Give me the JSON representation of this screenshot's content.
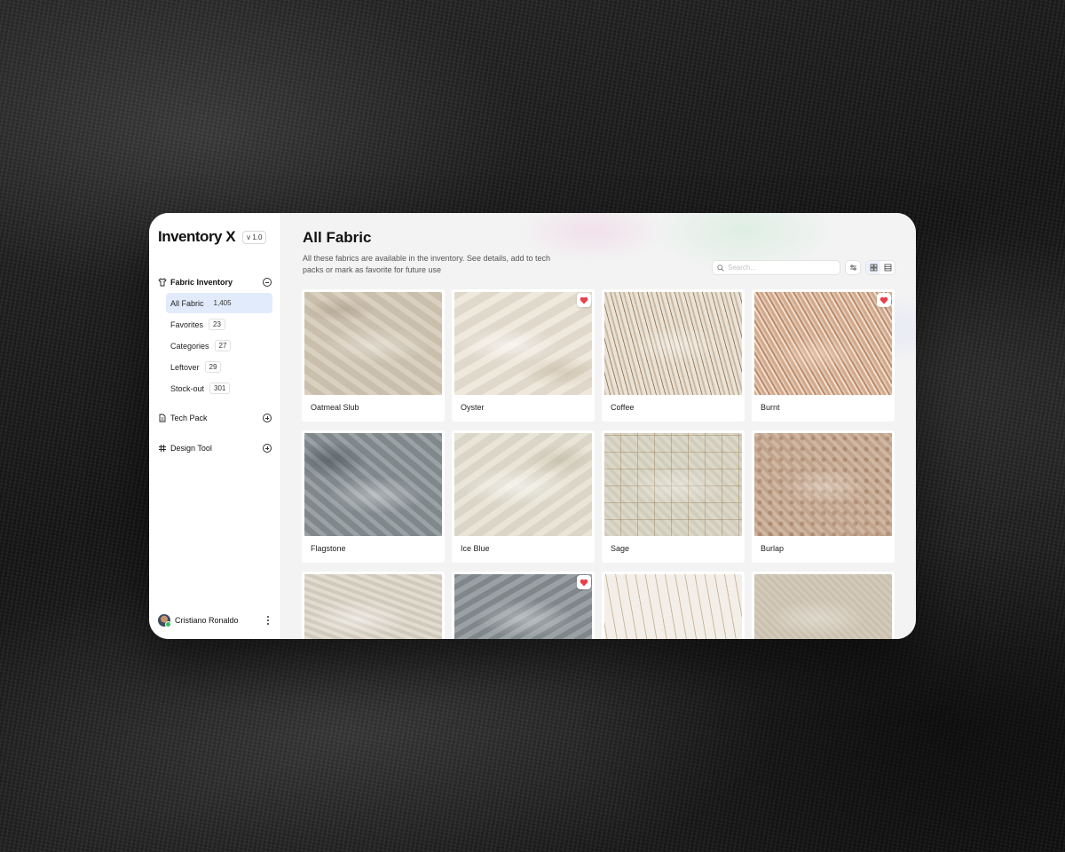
{
  "app": {
    "title": "Inventory X",
    "version": "v 1.0"
  },
  "sidebar": {
    "sections": [
      {
        "label": "Fabric Inventory",
        "icon": "shirt-icon",
        "expanded": true
      },
      {
        "label": "Tech Pack",
        "icon": "document-icon",
        "expanded": false
      },
      {
        "label": "Design Tool",
        "icon": "hash-grid-icon",
        "expanded": false
      }
    ],
    "items": [
      {
        "label": "All Fabric",
        "count": "1,405",
        "active": true
      },
      {
        "label": "Favorites",
        "count": "23"
      },
      {
        "label": "Categories",
        "count": "27"
      },
      {
        "label": "Leftover",
        "count": "29"
      },
      {
        "label": "Stock-out",
        "count": "301"
      }
    ],
    "user": {
      "name": "Cristiano Ronaldo",
      "status_color": "#32c05a"
    }
  },
  "main": {
    "title": "All Fabric",
    "description": "All these fabrics are available in the inventory. See details, add to tech packs or mark as favorite for future use",
    "search": {
      "placeholder": "Search...",
      "value": ""
    },
    "view_mode": "grid",
    "fabrics": [
      {
        "name": "Oatmeal Slub",
        "favorite": false
      },
      {
        "name": "Oyster",
        "favorite": true
      },
      {
        "name": "Coffee",
        "favorite": false
      },
      {
        "name": "Burnt",
        "favorite": true
      },
      {
        "name": "Flagstone",
        "favorite": false
      },
      {
        "name": "Ice Blue",
        "favorite": false
      },
      {
        "name": "Sage",
        "favorite": false
      },
      {
        "name": "Burlap",
        "favorite": false
      },
      {
        "name": "",
        "favorite": false
      },
      {
        "name": "",
        "favorite": true
      },
      {
        "name": "",
        "favorite": false
      },
      {
        "name": "",
        "favorite": false
      }
    ]
  },
  "colors": {
    "active_nav_bg": "#e2ebfb",
    "favorite_heart": "#e8404a",
    "window_bg": "#f4f4f4"
  }
}
